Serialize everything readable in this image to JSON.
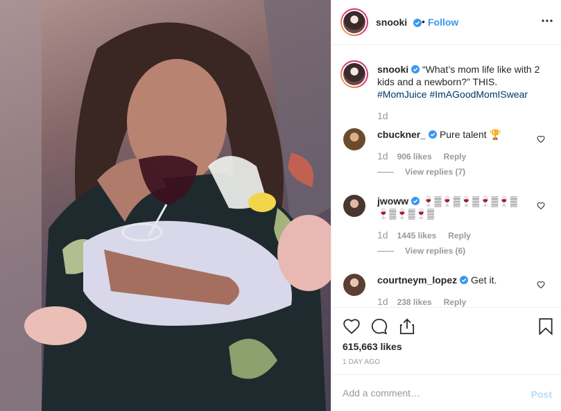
{
  "header": {
    "username": "snooki",
    "separator": "•",
    "follow_label": "Follow"
  },
  "caption": {
    "username": "snooki",
    "text": "“What’s mom life like with 2 kids and a newborn?” THIS.",
    "hashtags": "#MomJuice #ImAGoodMomISwear",
    "time": "1d"
  },
  "comments": [
    {
      "username": "cbuckner_",
      "text": "Pure talent 🏆",
      "time": "1d",
      "likes": "906 likes",
      "reply_label": "Reply",
      "view_replies": "View replies (7)"
    },
    {
      "username": "jwoww",
      "text": "🍷▒🍷▒🍷▒🍷▒🍷▒ 🍷▒🍷▒🍷▒",
      "time": "1d",
      "likes": "1445 likes",
      "reply_label": "Reply",
      "view_replies": "View replies (6)"
    },
    {
      "username": "courtneym_lopez",
      "text": "Get it.",
      "time": "1d",
      "likes": "238 likes",
      "reply_label": "Reply"
    }
  ],
  "post": {
    "likes": "615,663 likes",
    "date": "1 DAY AGO"
  },
  "comment_box": {
    "placeholder": "Add a comment…",
    "post_label": "Post"
  },
  "colors": {
    "link_blue": "#3897f0",
    "verified_blue": "#3897f0",
    "hashtag": "#003569",
    "muted": "#999999",
    "post_disabled": "#b2dffc"
  },
  "icons": {
    "verified": "verified-badge-icon",
    "more": "more-options-icon",
    "like": "heart-icon",
    "comment": "comment-bubble-icon",
    "share": "share-icon",
    "save": "bookmark-icon"
  }
}
